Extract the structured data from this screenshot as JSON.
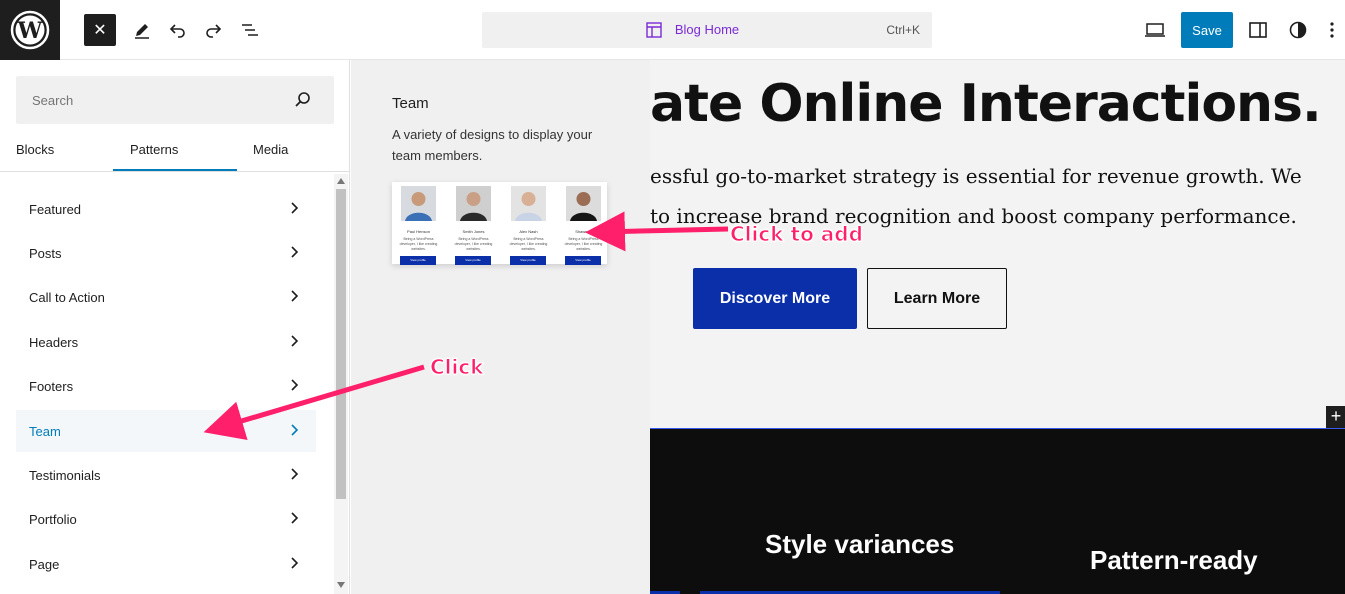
{
  "topbar": {
    "close_label": "✕",
    "command_bar": {
      "title": "Blog Home",
      "shortcut": "Ctrl+K"
    },
    "save_label": "Save"
  },
  "sidebar": {
    "search_placeholder": "Search",
    "tabs": [
      {
        "label": "Blocks"
      },
      {
        "label": "Patterns"
      },
      {
        "label": "Media"
      }
    ],
    "active_tab": "Patterns",
    "categories": [
      {
        "label": "Featured"
      },
      {
        "label": "Posts"
      },
      {
        "label": "Call to Action"
      },
      {
        "label": "Headers"
      },
      {
        "label": "Footers"
      },
      {
        "label": "Team"
      },
      {
        "label": "Testimonials"
      },
      {
        "label": "Portfolio"
      },
      {
        "label": "Page"
      }
    ],
    "active_category": "Team"
  },
  "pattern_panel": {
    "title": "Team",
    "description": "A variety of designs to display your team members.",
    "preview_members": [
      {
        "name": "Paul Henson",
        "desc": "Being a WordPress developer, I like creating websites.",
        "button": "View profile"
      },
      {
        "name": "Smith Jones",
        "desc": "Being a WordPress developer, I like creating websites.",
        "button": "View profile"
      },
      {
        "name": "Alex Nash",
        "desc": "Being a WordPress developer, I like creating websites.",
        "button": "View profile"
      },
      {
        "name": "Shawn Li",
        "desc": "Being a WordPress developer, I like creating websites.",
        "button": "View profile"
      }
    ]
  },
  "canvas": {
    "heading": "ate Online Interactions.",
    "paragraph_line1": "essful go-to-market strategy is essential for revenue growth. We",
    "paragraph_line2": "to increase brand recognition and boost company performance.",
    "primary_button": "Discover More",
    "secondary_button": "Learn More",
    "inserter_label": "+",
    "feature1": "Style variances",
    "feature2": "Pattern-ready"
  },
  "annotations": {
    "click_to_add": "Click to add",
    "click": "Click"
  },
  "colors": {
    "accent": "#007cba",
    "brand_blue": "#0a2fa8",
    "annotation": "#ff1f6b",
    "command_title": "#7a2bd6"
  }
}
